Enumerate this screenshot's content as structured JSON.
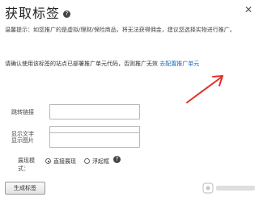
{
  "dialog": {
    "title": "获取标签",
    "close_glyph": "✕",
    "help_glyph": "?"
  },
  "notice": {
    "text": "温馨提示：如您推广的是虚拟/理财/保险商品，将无法获得佣金，建议您选择实物进行推广。"
  },
  "confirm": {
    "text": "请确认使用该标签的站点已部署推广单元代码，否则推广无效",
    "link": "去配置推广单元"
  },
  "form": {
    "fields": [
      {
        "label": "跳转链接",
        "value": ""
      },
      {
        "label": "显示文字",
        "value": ""
      },
      {
        "label": "显示图片",
        "value": ""
      }
    ],
    "display_mode_label": "展现模式：",
    "options": [
      {
        "label": "直接展现",
        "checked": true
      },
      {
        "label": "浮起框",
        "checked": false
      }
    ],
    "help_glyph": "?"
  },
  "actions": {
    "generate_label": "生成标签"
  },
  "annotation": {
    "arrow_color": "#e0302a"
  },
  "colors": {
    "link": "#1a6ac0"
  }
}
